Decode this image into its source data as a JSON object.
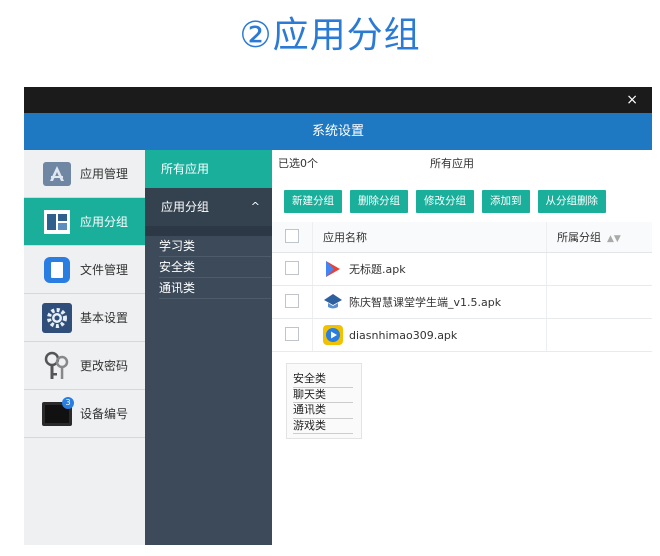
{
  "heading": "②应用分组",
  "window": {
    "close_label": "×",
    "title": "系统设置"
  },
  "nav": {
    "items": [
      {
        "label": "应用管理",
        "icon": "app-store-icon",
        "active": false
      },
      {
        "label": "应用分组",
        "icon": "app-group-icon",
        "active": true
      },
      {
        "label": "文件管理",
        "icon": "file-icon",
        "active": false
      },
      {
        "label": "基本设置",
        "icon": "gear-icon",
        "active": false
      },
      {
        "label": "更改密码",
        "icon": "key-icon",
        "active": false
      },
      {
        "label": "设备编号",
        "icon": "device-icon",
        "active": false,
        "badge": "3"
      }
    ]
  },
  "groups_panel": {
    "all_label": "所有应用",
    "header_label": "应用分组",
    "chevron": "^",
    "items": [
      "学习类",
      "安全类",
      "通讯类"
    ]
  },
  "content": {
    "selected_count": "已选0个",
    "current_group": "所有应用",
    "buttons": [
      "新建分组",
      "删除分组",
      "修改分组",
      "添加到",
      "从分组删除"
    ],
    "columns": [
      "应用名称",
      "所属分组"
    ],
    "rows": [
      {
        "name": "无标题.apk",
        "group": ""
      },
      {
        "name": "陈庆智慧课堂学生端_v1.5.apk",
        "group": ""
      },
      {
        "name": "diasnhimao309.apk",
        "group": ""
      }
    ],
    "group_options": [
      "安全类",
      "聊天类",
      "通讯类",
      "游戏类"
    ]
  },
  "colors": {
    "accent": "#1aaf9b",
    "header": "#1f78c2",
    "sidebar_dark": "#3c4a59"
  }
}
